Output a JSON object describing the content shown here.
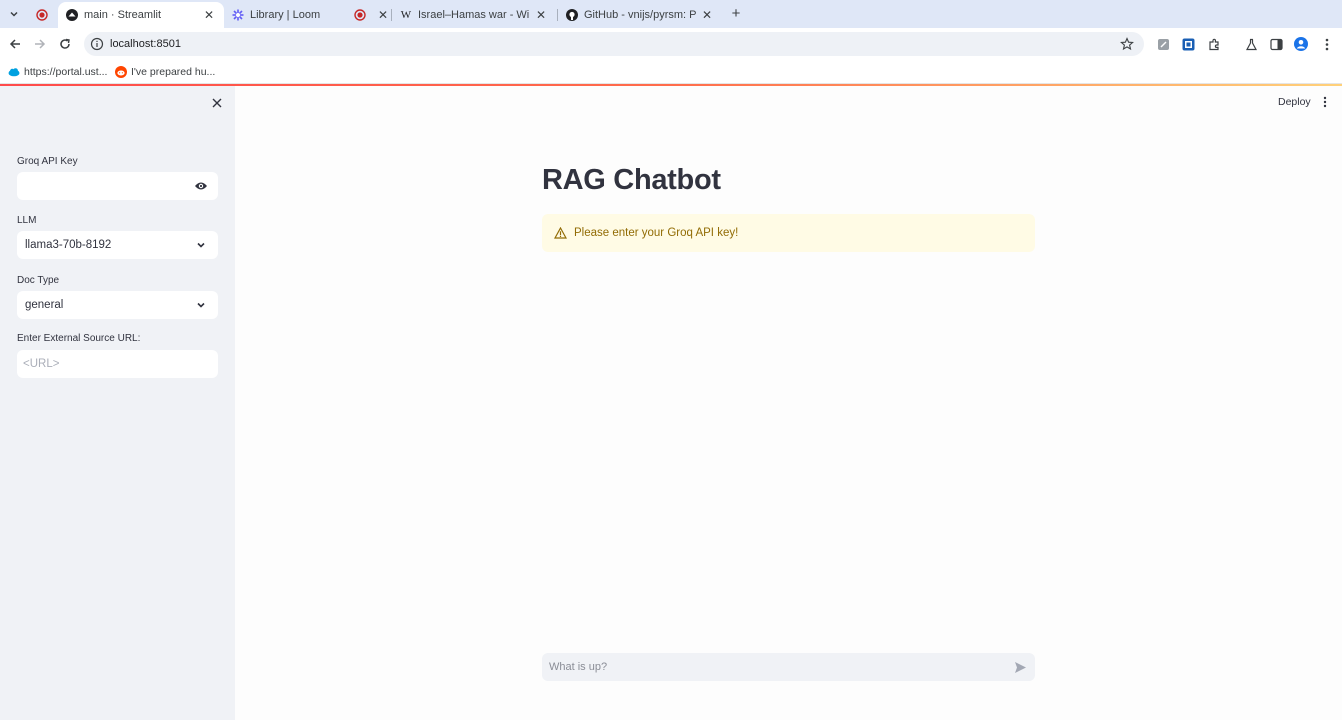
{
  "browser": {
    "tabs": [
      {
        "title": "",
        "favicon": "loom-record-icon",
        "closable": false
      },
      {
        "title": "main · Streamlit",
        "favicon": "streamlit-icon",
        "active": true
      },
      {
        "title": "Library | Loom",
        "favicon": "loom-icon"
      },
      {
        "title": "",
        "favicon": "loom-record-icon"
      },
      {
        "title": "Israel–Hamas war - Wikipedia",
        "favicon": "wikipedia-icon"
      },
      {
        "title": "GitHub - vnijs/pyrsm: Python",
        "favicon": "github-icon"
      }
    ],
    "address": "localhost:8501",
    "bookmarks": [
      {
        "label": "https://portal.ust...",
        "icon": "salesforce-cloud-icon"
      },
      {
        "label": "I've prepared hu...",
        "icon": "reddit-icon"
      }
    ]
  },
  "sidebar": {
    "api_key_label": "Groq API Key",
    "api_key_value": "",
    "llm_label": "LLM",
    "llm_value": "llama3-70b-8192",
    "doc_type_label": "Doc Type",
    "doc_type_value": "general",
    "url_label": "Enter External Source URL:",
    "url_placeholder": "<URL>"
  },
  "header": {
    "deploy_label": "Deploy"
  },
  "main": {
    "title": "RAG Chatbot",
    "warning": "Please enter your Groq API key!",
    "chat_placeholder": "What is up?"
  },
  "colors": {
    "accent": "#ff4b4b",
    "sidebar_bg": "#f0f2f6",
    "warning_bg": "#fffbe5",
    "warning_text": "#926c05"
  }
}
